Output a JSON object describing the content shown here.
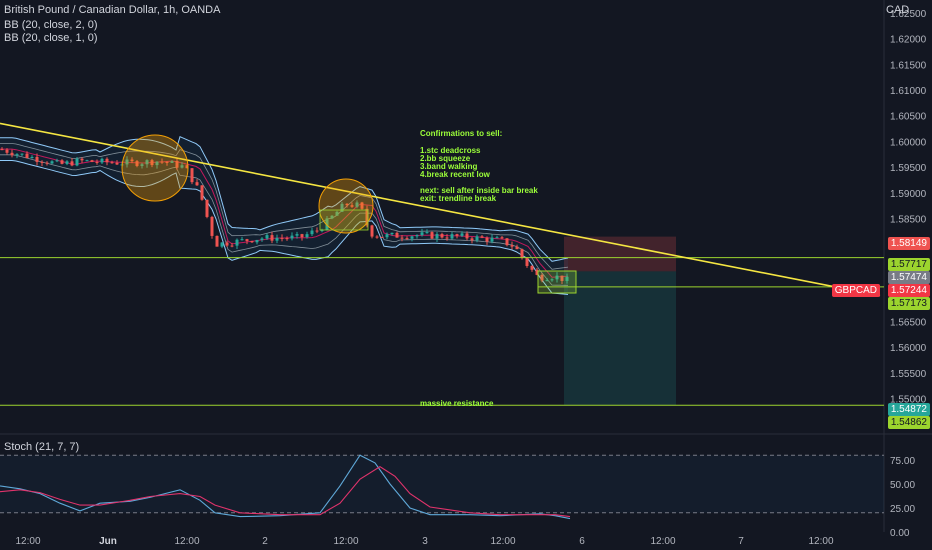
{
  "header": {
    "symbol_title": "British Pound / Canadian Dollar, 1h, OANDA",
    "indicator_1": "BB (20, close, 2, 0)",
    "indicator_2": "BB (20, close, 1, 0)",
    "currency": "CAD"
  },
  "annotations": {
    "confirmations_title": "Confirmations to sell:",
    "confirmations": [
      "1.stc deadcross",
      "2.bb squeeze",
      "3.band walking",
      "4.break recent low"
    ],
    "next": "next: sell after inside bar break",
    "exit": "exit: trendline break",
    "resistance_label": "massive resistance"
  },
  "price_labels": {
    "stop": "1.58149",
    "upper_green": "1.57717",
    "entry_grey": "1.57474",
    "symbol": "GBPCAD",
    "current": "1.57244",
    "lower_green": "1.57173",
    "resistance_teal": "1.54872",
    "resistance_green": "1.54862"
  },
  "oscillator": {
    "title": "Stoch (21, 7, 7)",
    "ticks": [
      "75.00",
      "50.00",
      "25.00",
      "0.00"
    ]
  },
  "colors": {
    "background": "#131722",
    "up": "#26a69a",
    "down": "#ef5350",
    "trendline": "#f5e642",
    "support": "#9cd42e",
    "annotation_text": "#9cff3a",
    "stop_zone": "#ef5350",
    "target_zone": "#26a69a",
    "circle": "#f29f05"
  },
  "chart_data": {
    "type": "candlestick",
    "y_axis": {
      "range": [
        1.5435,
        1.6275
      ],
      "ticks": [
        "1.62500",
        "1.62000",
        "1.61500",
        "1.61000",
        "1.60500",
        "1.60000",
        "1.59500",
        "1.59000",
        "1.58500",
        "1.58000",
        "1.57500",
        "1.57000",
        "1.56500",
        "1.56000",
        "1.55500",
        "1.55000",
        "1.54500"
      ]
    },
    "x_axis": {
      "labels": [
        "12:00",
        "Jun",
        "12:00",
        "2",
        "12:00",
        "3",
        "12:00",
        "6",
        "12:00",
        "7",
        "12:00"
      ]
    },
    "price_path": [
      [
        0,
        1.5985
      ],
      [
        40,
        1.5965
      ],
      [
        60,
        1.5955
      ],
      [
        80,
        1.5962
      ],
      [
        100,
        1.596
      ],
      [
        130,
        1.5958
      ],
      [
        160,
        1.5962
      ],
      [
        185,
        1.595
      ],
      [
        200,
        1.59
      ],
      [
        215,
        1.58
      ],
      [
        235,
        1.5805
      ],
      [
        260,
        1.5812
      ],
      [
        300,
        1.5813
      ],
      [
        320,
        1.583
      ],
      [
        345,
        1.5878
      ],
      [
        360,
        1.5875
      ],
      [
        370,
        1.5822
      ],
      [
        380,
        1.5816
      ],
      [
        420,
        1.5818
      ],
      [
        460,
        1.5815
      ],
      [
        500,
        1.5808
      ],
      [
        515,
        1.5795
      ],
      [
        525,
        1.5765
      ],
      [
        538,
        1.5736
      ],
      [
        555,
        1.5738
      ],
      [
        570,
        1.5728
      ]
    ],
    "levels": {
      "support": 1.5774,
      "resistance": 1.5487,
      "stop": 1.58149,
      "entry": 1.57474,
      "current": 1.57244,
      "target": 1.5487
    },
    "trendline": {
      "from": [
        0,
        1.6035
      ],
      "to": [
        880,
        1.57
      ]
    },
    "stoch": {
      "range": [
        0,
        100
      ],
      "k": [
        [
          0,
          48
        ],
        [
          20,
          45
        ],
        [
          40,
          40
        ],
        [
          60,
          30
        ],
        [
          80,
          22
        ],
        [
          100,
          30
        ],
        [
          130,
          32
        ],
        [
          150,
          36
        ],
        [
          180,
          44
        ],
        [
          200,
          33
        ],
        [
          215,
          20
        ],
        [
          240,
          16
        ],
        [
          280,
          17
        ],
        [
          320,
          20
        ],
        [
          340,
          48
        ],
        [
          360,
          80
        ],
        [
          375,
          72
        ],
        [
          390,
          50
        ],
        [
          410,
          25
        ],
        [
          430,
          18
        ],
        [
          470,
          18
        ],
        [
          500,
          17
        ],
        [
          540,
          19
        ],
        [
          555,
          17
        ],
        [
          570,
          14
        ]
      ],
      "d": [
        [
          0,
          42
        ],
        [
          20,
          44
        ],
        [
          40,
          41
        ],
        [
          60,
          34
        ],
        [
          80,
          28
        ],
        [
          100,
          28
        ],
        [
          130,
          33
        ],
        [
          150,
          37
        ],
        [
          180,
          40
        ],
        [
          200,
          37
        ],
        [
          215,
          28
        ],
        [
          240,
          20
        ],
        [
          280,
          18
        ],
        [
          320,
          18
        ],
        [
          340,
          30
        ],
        [
          360,
          55
        ],
        [
          380,
          68
        ],
        [
          395,
          58
        ],
        [
          410,
          40
        ],
        [
          430,
          26
        ],
        [
          470,
          20
        ],
        [
          500,
          18
        ],
        [
          540,
          18
        ],
        [
          555,
          18
        ],
        [
          570,
          16
        ]
      ]
    }
  }
}
